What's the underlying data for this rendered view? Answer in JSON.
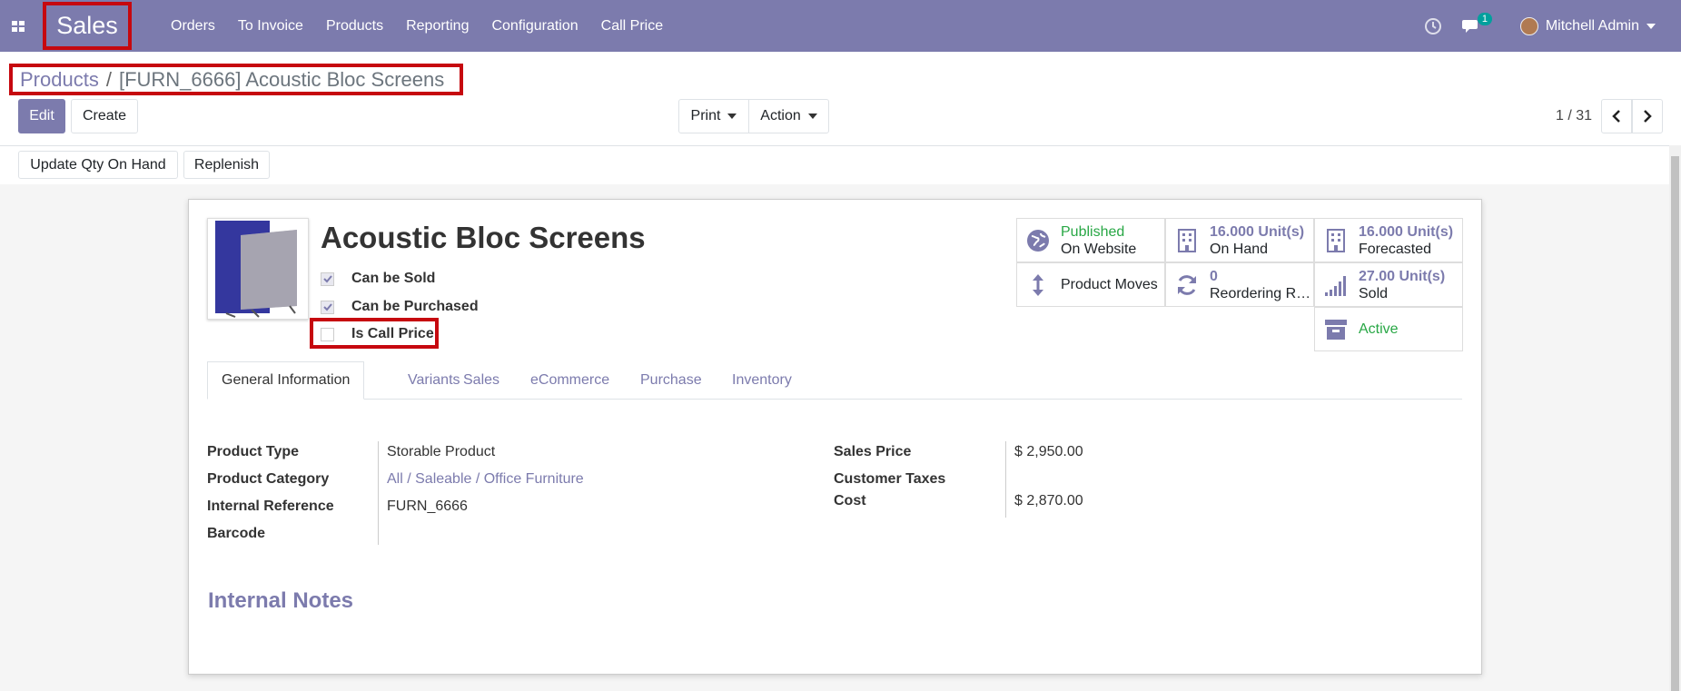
{
  "navbar": {
    "app_name": "Sales",
    "menu": [
      "Orders",
      "To Invoice",
      "Products",
      "Reporting",
      "Configuration",
      "Call Price"
    ],
    "chat_badge": "1",
    "user": "Mitchell Admin",
    "color": "#7c7bad"
  },
  "breadcrumb": {
    "parent": "Products",
    "separator": "/",
    "current": "[FURN_6666] Acoustic Bloc Screens"
  },
  "control": {
    "edit": "Edit",
    "create": "Create",
    "print": "Print",
    "action": "Action",
    "pager": "1 / 31"
  },
  "header_buttons": {
    "update_qty": "Update Qty On Hand",
    "replenish": "Replenish"
  },
  "product": {
    "name": "Acoustic Bloc Screens",
    "can_be_sold": {
      "label": "Can be Sold",
      "checked": true
    },
    "can_be_purchased": {
      "label": "Can be Purchased",
      "checked": true
    },
    "is_call_price": {
      "label": "Is Call Price",
      "checked": false
    }
  },
  "stats": {
    "published": {
      "line1": "Published",
      "line2": "On Website"
    },
    "on_hand": {
      "value": "16.000 Unit(s)",
      "label": "On Hand"
    },
    "forecasted": {
      "value": "16.000 Unit(s)",
      "label": "Forecasted"
    },
    "moves": {
      "label": "Product Moves"
    },
    "reordering": {
      "value": "0",
      "label": "Reordering R…"
    },
    "sold": {
      "value": "27.00 Unit(s)",
      "label": "Sold"
    },
    "active": {
      "label": "Active"
    }
  },
  "tabs": [
    "General Information",
    "Variants",
    "Sales",
    "eCommerce",
    "Purchase",
    "Inventory"
  ],
  "general": {
    "product_type": {
      "label": "Product Type",
      "value": "Storable Product"
    },
    "product_category": {
      "label": "Product Category",
      "value": "All / Saleable / Office Furniture"
    },
    "internal_reference": {
      "label": "Internal Reference",
      "value": "FURN_6666"
    },
    "barcode": {
      "label": "Barcode",
      "value": ""
    },
    "sales_price": {
      "label": "Sales Price",
      "value": "$ 2,950.00"
    },
    "customer_taxes": {
      "label": "Customer Taxes",
      "value": ""
    },
    "cost": {
      "label": "Cost",
      "value": "$ 2,870.00"
    }
  },
  "internal_notes": "Internal Notes"
}
